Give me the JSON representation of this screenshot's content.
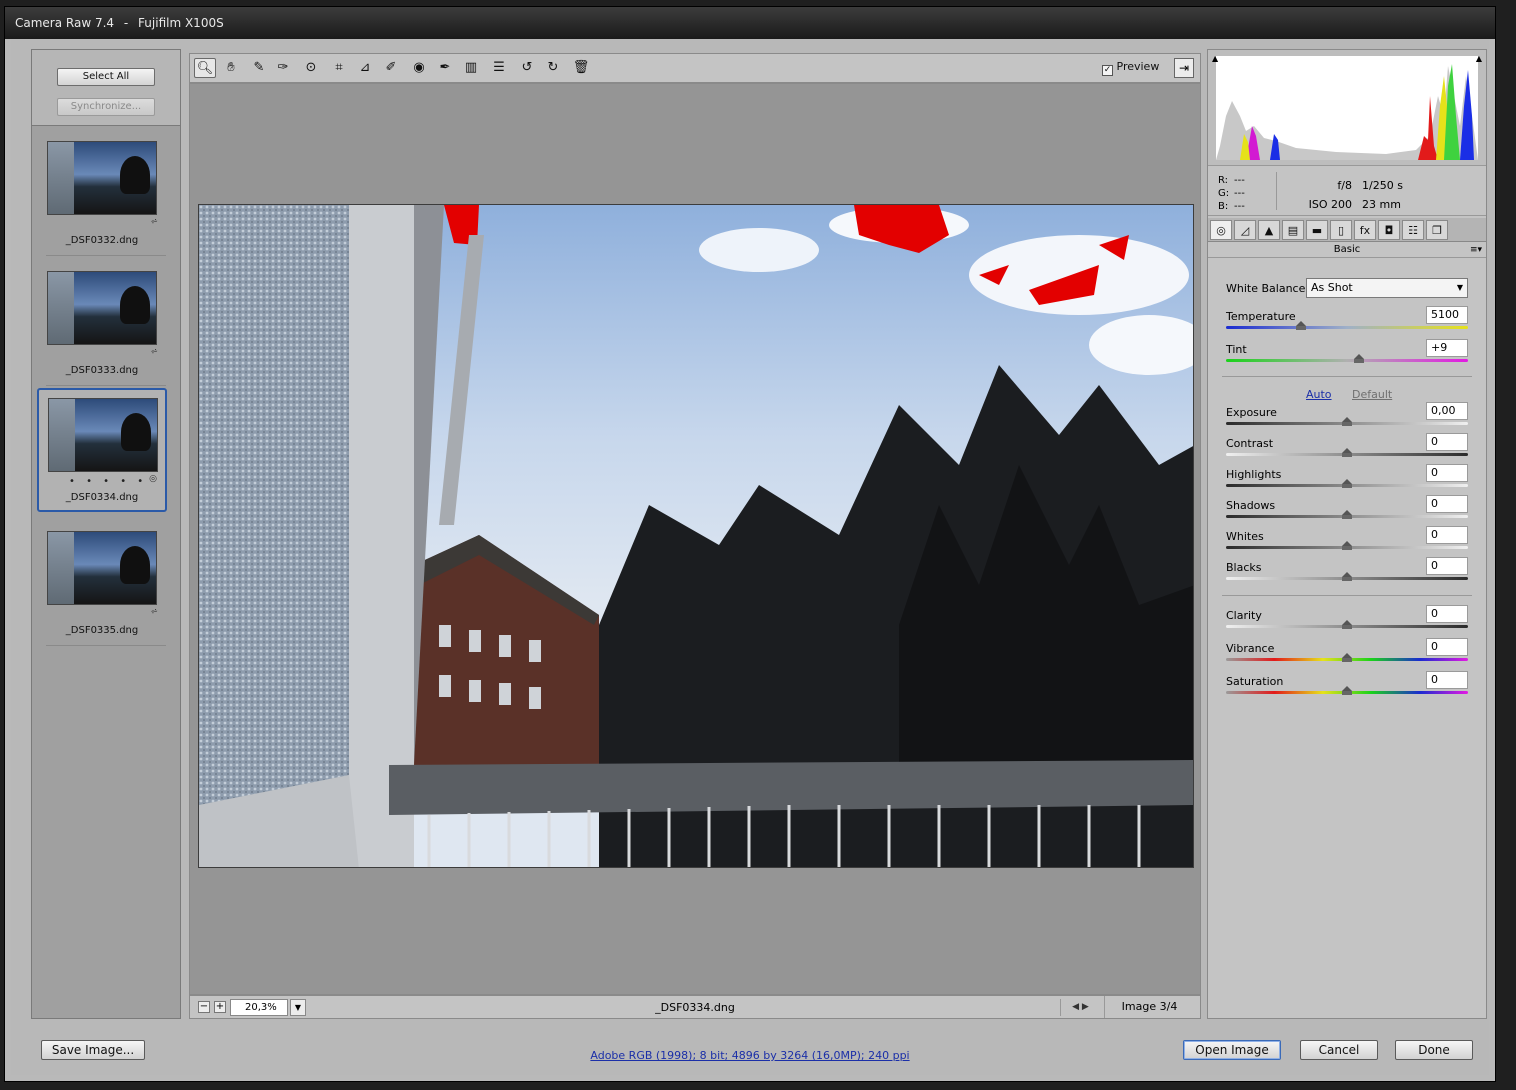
{
  "window": {
    "title_app": "Camera Raw 7.4",
    "title_sep": "-",
    "title_camera": "Fujifilm X100S"
  },
  "filmstrip": {
    "select_all": "Select All",
    "synchronize": "Synchronize...",
    "items": [
      {
        "name": "_DSF0332.dng"
      },
      {
        "name": "_DSF0333.dng"
      },
      {
        "name": "_DSF0334.dng",
        "dots": "• • • • •"
      },
      {
        "name": "_DSF0335.dng"
      }
    ]
  },
  "toolbar": {
    "tools": [
      "zoom-icon",
      "hand-icon",
      "white-balance-icon",
      "color-sampler-icon",
      "target-adjust-icon",
      "crop-icon",
      "straighten-icon",
      "spot-removal-icon",
      "red-eye-icon",
      "adjustment-brush-icon",
      "graduated-filter-icon",
      "preferences-icon",
      "rotate-left-icon",
      "rotate-right-icon",
      "trash-icon"
    ],
    "preview_label": "Preview",
    "preview_checked": "✓"
  },
  "status": {
    "zoom_minus": "−",
    "zoom_plus": "+",
    "zoom_value": "20,3%",
    "filename": "_DSF0334.dng",
    "nav": "◀  ▶",
    "image_count": "Image 3/4"
  },
  "info": {
    "r": "R:",
    "g": "G:",
    "b": "B:",
    "placeholder": "---",
    "aperture": "f/8",
    "shutter": "1/250 s",
    "iso": "ISO 200",
    "focal": "23 mm"
  },
  "panel": {
    "title": "Basic",
    "menu": "≡▾",
    "white_balance_label": "White Balance:",
    "white_balance_value": "As Shot",
    "temperature_label": "Temperature",
    "temperature_value": "5100",
    "temperature_pos": 0.31,
    "tint_label": "Tint",
    "tint_value": "+9",
    "tint_pos": 0.55,
    "auto": "Auto",
    "default": "Default",
    "sliders": [
      {
        "label": "Exposure",
        "value": "0,00",
        "pos": 0.5
      },
      {
        "label": "Contrast",
        "value": "0",
        "pos": 0.5
      },
      {
        "label": "Highlights",
        "value": "0",
        "pos": 0.5
      },
      {
        "label": "Shadows",
        "value": "0",
        "pos": 0.5
      },
      {
        "label": "Whites",
        "value": "0",
        "pos": 0.5
      },
      {
        "label": "Blacks",
        "value": "0",
        "pos": 0.5
      }
    ],
    "presence": [
      {
        "label": "Clarity",
        "value": "0",
        "pos": 0.5
      },
      {
        "label": "Vibrance",
        "value": "0",
        "pos": 0.5
      },
      {
        "label": "Saturation",
        "value": "0",
        "pos": 0.5
      }
    ]
  },
  "bottom": {
    "save": "Save Image...",
    "workflow": "Adobe RGB (1998); 8 bit; 4896 by 3264 (16,0MP); 240 ppi",
    "open": "Open Image",
    "cancel": "Cancel",
    "done": "Done"
  }
}
